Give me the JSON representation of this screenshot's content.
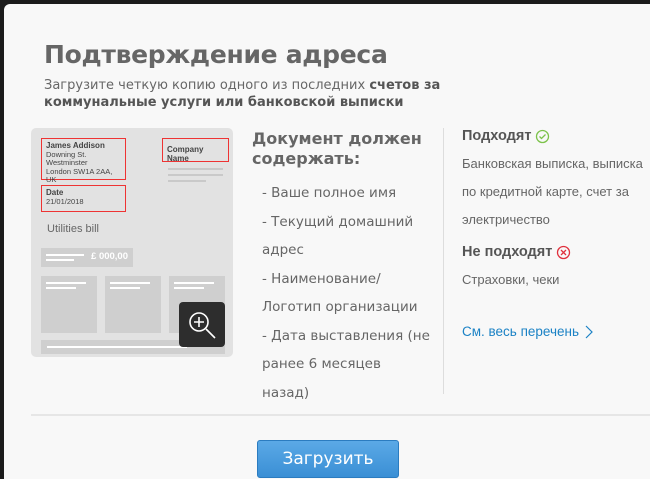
{
  "header": {
    "title": "Подтверждение адреса",
    "subtitle_plain": "Загрузите четкую копию одного из последних ",
    "subtitle_bold": "счетов за коммунальные услуги или банковской выписки"
  },
  "sample": {
    "name": "James Addison",
    "addr1": "Downing St.",
    "addr2": "Westminster",
    "addr3": "London SW1A 2AA, UK",
    "company": "Company Name",
    "date_label": "Date",
    "date": "21/01/2018",
    "doc_type": "Utilities bill",
    "amount": "£ 000,00"
  },
  "requirements": {
    "heading": "Документ должен содержать:",
    "items": [
      "- Ваше полное имя",
      "- Текущий домашний адрес",
      "- Наименование/Логотип организации",
      "- Дата выставления (не ранее 6 месяцев назад)"
    ]
  },
  "accepted": {
    "heading": "Подходят",
    "text": "Банковская выписка, выписка по кредитной карте, счет за электричество"
  },
  "rejected": {
    "heading": "Не подходят",
    "text": "Страховки, чеки"
  },
  "link": "См. весь перечень",
  "upload_button": "Загрузить",
  "colors": {
    "accent": "#3a8fd5",
    "ok": "#7cc24a",
    "bad": "#e0303d",
    "link": "#1b82c5"
  }
}
